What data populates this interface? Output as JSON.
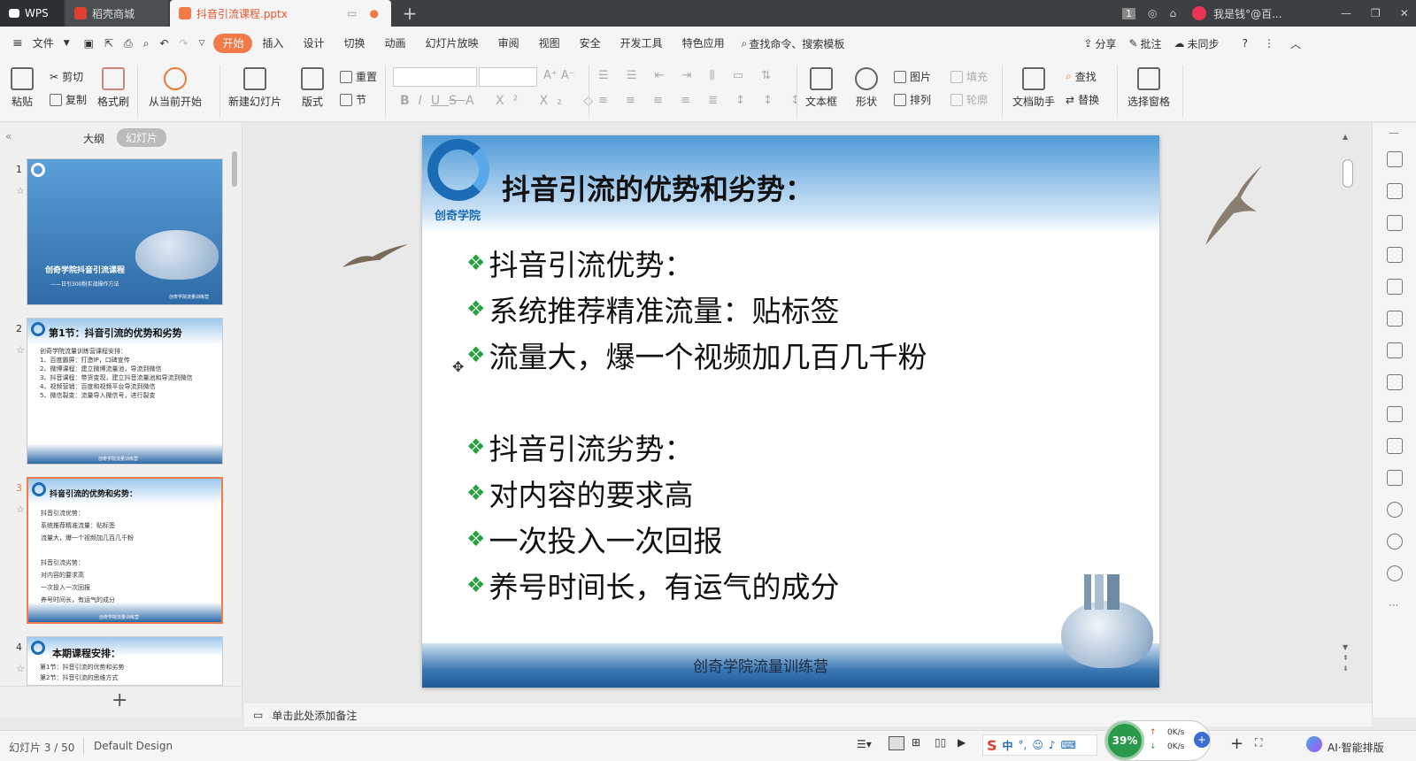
{
  "titlebar": {
    "app_tab": "WPS",
    "store_tab": "稻壳商城",
    "doc_tab": "抖音引流课程.pptx",
    "page_badge": "1",
    "user": "我是钱°@百..."
  },
  "menu": {
    "file": "文件",
    "items": [
      "开始",
      "插入",
      "设计",
      "切换",
      "动画",
      "幻灯片放映",
      "审阅",
      "视图",
      "安全",
      "开发工具",
      "特色应用"
    ],
    "search": "查找命令、搜索模板",
    "share": "分享",
    "comment": "批注",
    "sync": "未同步"
  },
  "ribbon": {
    "paste": "粘贴",
    "cut": "剪切",
    "copy": "复制",
    "format_painter": "格式刷",
    "from_current": "从当前开始",
    "new_slide": "新建幻灯片",
    "layout": "版式",
    "reset": "重置",
    "section": "节",
    "textbox": "文本框",
    "shape": "形状",
    "picture": "图片",
    "fill": "填充",
    "arrange": "排列",
    "outline": "轮廓",
    "doc_helper": "文档助手",
    "find": "查找",
    "replace": "替换",
    "select_pane": "选择窗格"
  },
  "panel": {
    "outline_tab": "大纲",
    "slides_tab": "幻灯片",
    "thumbs": [
      {
        "num": "1",
        "title": "创奇学院抖音引流课程",
        "sub": "——日引300粉实战操作方法",
        "footer": "创奇学院流量训练营"
      },
      {
        "num": "2",
        "title": "第1节：抖音引流的优势和劣势",
        "lines": [
          "创奇学院流量训练营课程安排：",
          "1、百度霸屏：打造IP，口碑宣传",
          "2、微博课程：建立微博流量池，导流到微信",
          "3、抖音课程：带货变现，建立抖音流量池和导流到微信",
          "4、视频营销：百度和视频平台导流到微信",
          "5、微信裂变：流量导入微信号，进行裂变"
        ],
        "footer": "创奇学院流量训练营"
      },
      {
        "num": "3",
        "title": "抖音引流的优势和劣势：",
        "lines": [
          "抖音引流优势：",
          "系统推荐精准流量：贴标签",
          "流量大，爆一个视频加几百几千粉",
          "",
          "抖音引流劣势：",
          "对内容的要求高",
          "一次投入一次回报",
          "养号时间长，有运气的成分"
        ],
        "footer": "创奇学院流量训练营"
      },
      {
        "num": "4",
        "title": "本期课程安排：",
        "lines": [
          "第1节：抖音引流的优势和劣势",
          "第2节：抖音引流的思维方式"
        ]
      }
    ]
  },
  "slide": {
    "logo_text": "创奇学院",
    "title": "抖音引流的优势和劣势：",
    "bullets": [
      "抖音引流优势：",
      "系统推荐精准流量：贴标签",
      "流量大，爆一个视频加几百几千粉",
      "抖音引流劣势：",
      "对内容的要求高",
      "一次投入一次回报",
      "养号时间长，有运气的成分"
    ],
    "footer": "创奇学院流量训练营"
  },
  "notes": {
    "placeholder": "单击此处添加备注"
  },
  "status": {
    "slide_counter": "幻灯片 3 / 50",
    "theme": "Default Design",
    "ime": "中",
    "net_percent": "39%",
    "upload": "0K/s",
    "download": "0K/s",
    "ai_layout": "AI·智能排版"
  },
  "colors": {
    "accent": "#f07a48",
    "bullet": "#2aa043",
    "titlebar": "#3c4043"
  }
}
